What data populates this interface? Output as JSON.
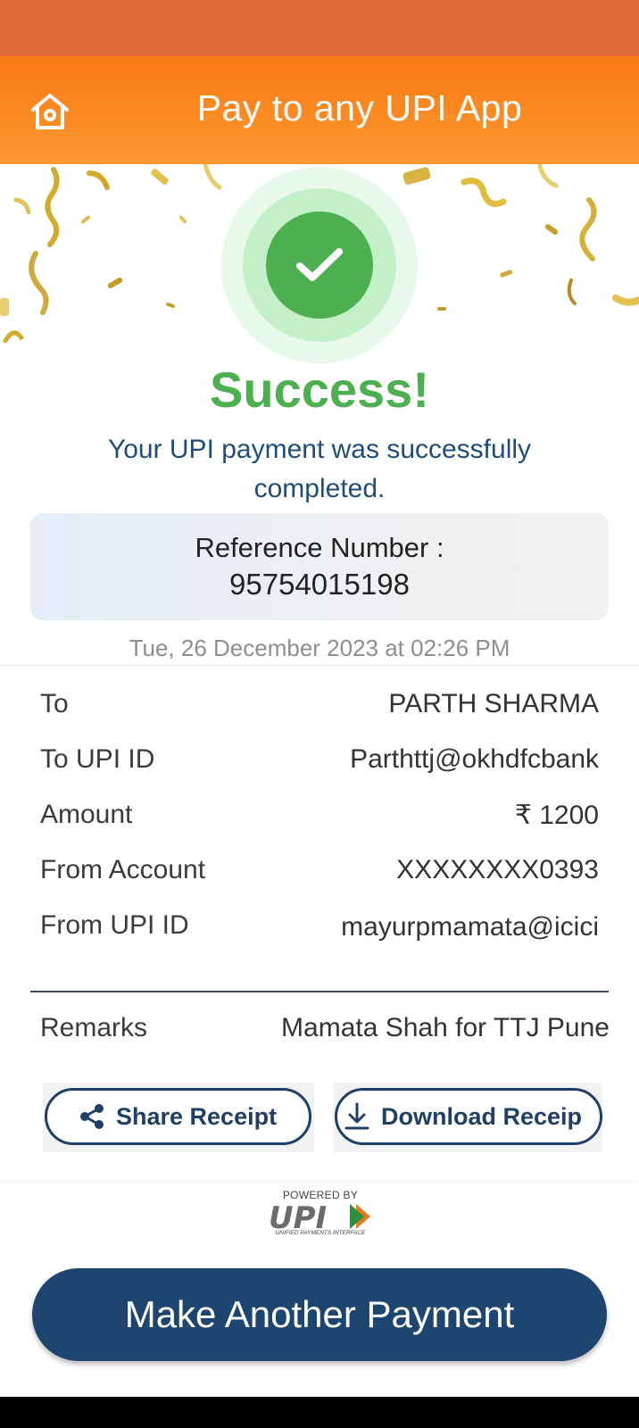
{
  "header": {
    "title": "Pay to any UPI App",
    "home_icon": "home-icon"
  },
  "status": {
    "title": "Success!",
    "message": "Your UPI payment was successfully completed.",
    "icon": "check-icon",
    "color": "#4caf50"
  },
  "reference": {
    "label": "Reference Number :",
    "value": "95754015198"
  },
  "timestamp": "Tue, 26 December 2023 at 02:26 PM",
  "details": [
    {
      "label": "To",
      "value": "PARTH SHARMA"
    },
    {
      "label": "To UPI ID",
      "value": "Parthttj@okhdfcbank"
    },
    {
      "label": "Amount",
      "value": "₹ 1200"
    },
    {
      "label": "From Account",
      "value": "XXXXXXXX0393"
    },
    {
      "label": "From UPI ID",
      "value": "mayurpmamata@icici"
    }
  ],
  "remarks": {
    "label": "Remarks",
    "value": "Mamata Shah for TTJ Pune"
  },
  "actions": {
    "share_label": "Share Receipt",
    "download_label": "Download Receip"
  },
  "powered": {
    "by": "POWERED BY",
    "brand": "UPI",
    "tagline": "UNIFIED PAYMENTS INTERFACE"
  },
  "cta": {
    "label": "Make Another Payment"
  },
  "colors": {
    "header": "#fb8a23",
    "status_bar": "#e0693a",
    "primary": "#1e4470",
    "success": "#4caf50"
  }
}
